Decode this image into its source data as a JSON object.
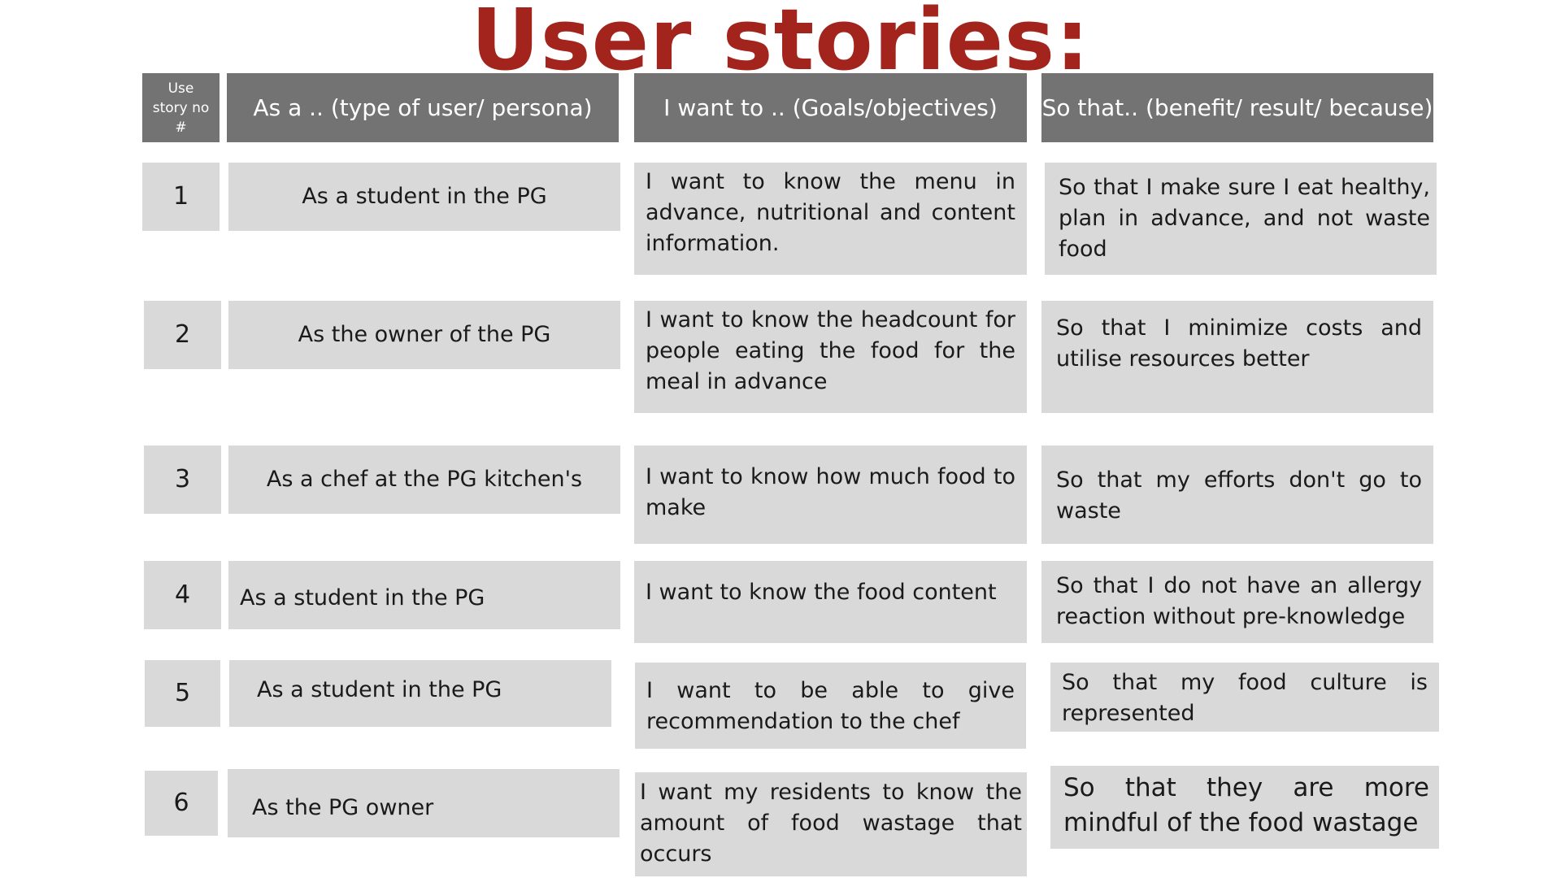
{
  "title": "User stories:",
  "headers": {
    "story_no": "Use story no #",
    "as_a": "As a .. (type of user/ persona)",
    "i_want": "I want to .. (Goals/objectives)",
    "so_that": "So that.. (benefit/ result/ because)"
  },
  "rows": [
    {
      "no": "1",
      "as_a": "As a student in the PG",
      "i_want": "I want to know the menu in advance, nutritional and content information.",
      "so_that": "So that I make sure I eat healthy, plan in advance, and not waste food"
    },
    {
      "no": "2",
      "as_a": "As the owner of the PG",
      "i_want": "I want to know the headcount for people eating the food for the meal in advance",
      "so_that": "So that I minimize costs and utilise resources better"
    },
    {
      "no": "3",
      "as_a": "As a chef at the PG kitchen's",
      "i_want": "I want to know how much food to make",
      "so_that": "So that my efforts don't go to waste"
    },
    {
      "no": "4",
      "as_a": "As a student in the PG",
      "i_want": "I want to know the food content",
      "so_that": "So that I  do not have an allergy reaction without pre-knowledge"
    },
    {
      "no": "5",
      "as_a": "As a student in the PG",
      "i_want": "I want to be able to give recommendation to the chef",
      "so_that": "So that my food culture is represented"
    },
    {
      "no": "6",
      "as_a": "As the PG owner",
      "i_want": "I want my residents to know the amount of food wastage that occurs",
      "so_that": "So that they are more mindful of the food wastage"
    }
  ]
}
